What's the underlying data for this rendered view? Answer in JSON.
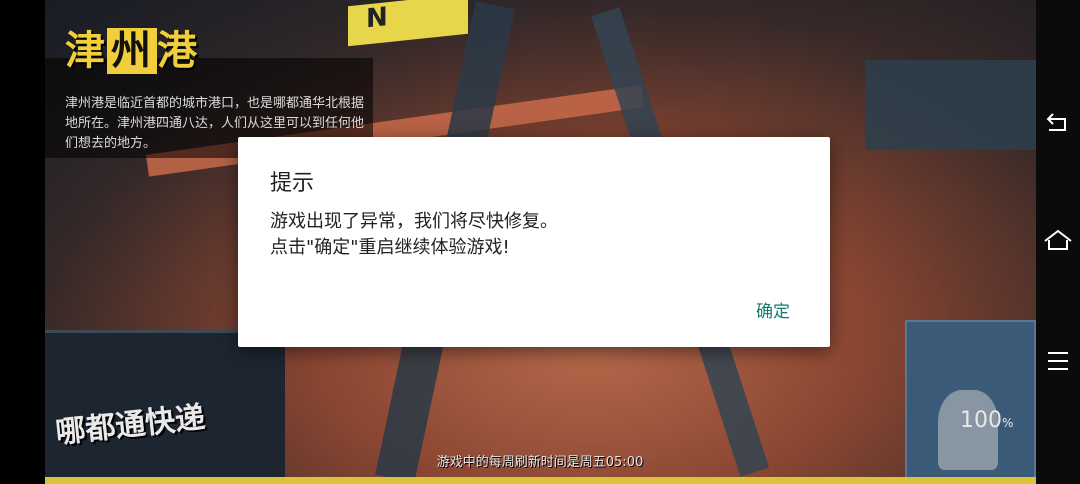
{
  "location": {
    "title_parts": [
      "津",
      "州",
      "港"
    ],
    "description": "津州港是临近首都的城市港口，也是哪都通华北根据地所在。津州港四通八达，人们从这里可以到任何他们想去的地方。"
  },
  "dialog": {
    "title": "提示",
    "message_line1": "游戏出现了异常，我们将尽快修复。",
    "message_line2": "点击\"确定\"重启继续体验游戏!",
    "ok_label": "确定"
  },
  "status": {
    "battery": "100",
    "battery_unit": "%"
  },
  "footer": {
    "tip": "游戏中的每周刷新时间是周五05:00"
  },
  "side_nav": {
    "icons": [
      "back-icon",
      "home-icon",
      "menu-icon"
    ]
  },
  "colors": {
    "accent": "#157a6e",
    "stripe": "#d8c436"
  }
}
